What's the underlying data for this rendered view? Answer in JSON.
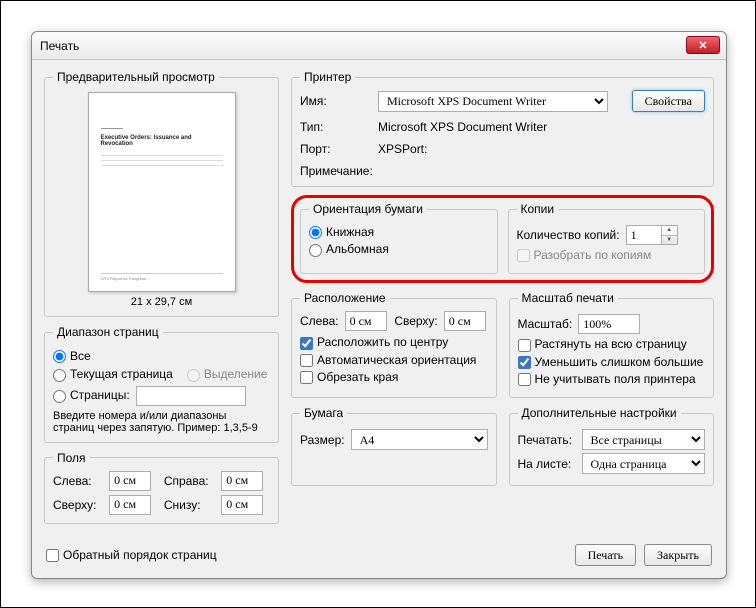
{
  "window": {
    "title": "Печать"
  },
  "preview": {
    "legend": "Предварительный просмотр",
    "size_text": "21 x 29,7 см"
  },
  "printer": {
    "legend": "Принтер",
    "name_label": "Имя:",
    "name_value": "Microsoft XPS Document Writer",
    "type_label": "Тип:",
    "type_value": "Microsoft XPS Document Writer",
    "port_label": "Порт:",
    "port_value": "XPSPort:",
    "note_label": "Примечание:",
    "props_btn": "Свойства"
  },
  "orientation": {
    "legend": "Ориентация бумаги",
    "portrait": "Книжная",
    "landscape": "Альбомная"
  },
  "copies": {
    "legend": "Копии",
    "count_label": "Количество копий:",
    "count_value": "1",
    "collate": "Разобрать по копиям"
  },
  "range": {
    "legend": "Диапазон страниц",
    "all": "Все",
    "current": "Текущая страница",
    "selection": "Выделение",
    "pages": "Страницы:",
    "hint": "Введите номера и/или диапазоны страниц через запятую. Пример: 1,3,5-9"
  },
  "layout": {
    "legend": "Расположение",
    "left": "Слева:",
    "left_val": "0 см",
    "top": "Сверху:",
    "top_val": "0 см",
    "center": "Расположить по центру",
    "auto_orient": "Автоматическая ориентация",
    "crop": "Обрезать края"
  },
  "scale": {
    "legend": "Масштаб печати",
    "scale_label": "Масштаб:",
    "scale_value": "100%",
    "stretch": "Растянуть на всю страницу",
    "shrink": "Уменьшить слишком большие",
    "ignore_margins": "Не учитывать поля принтера"
  },
  "margins": {
    "legend": "Поля",
    "left": "Слева:",
    "left_val": "0 см",
    "right": "Справа:",
    "right_val": "0 см",
    "top": "Сверху:",
    "top_val": "0 см",
    "bottom": "Снизу:",
    "bottom_val": "0 см"
  },
  "paper": {
    "legend": "Бумага",
    "size_label": "Размер:",
    "size_value": "A4"
  },
  "extra": {
    "legend": "Дополнительные настройки",
    "print_label": "Печатать:",
    "print_value": "Все страницы",
    "sheet_label": "На листе:",
    "sheet_value": "Одна страница"
  },
  "footer": {
    "reverse": "Обратный порядок страниц",
    "print_btn": "Печать",
    "close_btn": "Закрыть"
  }
}
